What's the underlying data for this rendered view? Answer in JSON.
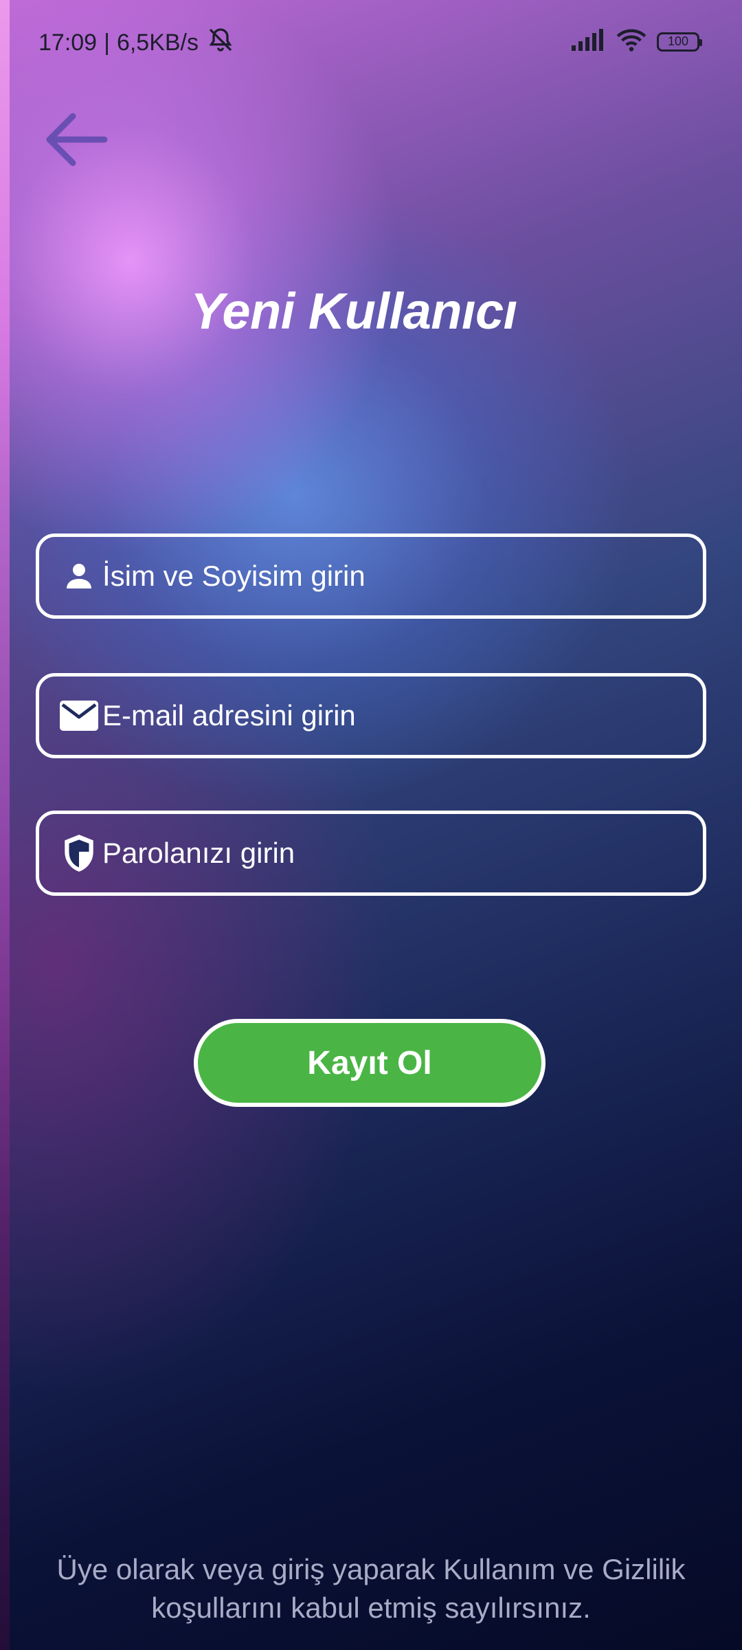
{
  "status_bar": {
    "time": "17:09",
    "separator": "|",
    "speed": "6,5KB/s",
    "battery": "100"
  },
  "header": {
    "title": "Yeni Kullanıcı"
  },
  "form": {
    "name_placeholder": "İsim ve Soyisim girin",
    "email_placeholder": "E-mail adresini girin",
    "password_placeholder": "Parolanızı girin",
    "submit_label": "Kayıt Ol"
  },
  "footer": {
    "terms_line1": "Üye olarak veya giriş yaparak Kullanım ve Gizlilik",
    "terms_line2": "koşullarını kabul etmiş sayılırsınız."
  },
  "icons": {
    "back": "arrow-left-icon",
    "name": "person-icon",
    "email": "envelope-icon",
    "password": "shield-icon",
    "mute": "bell-off-icon",
    "signal": "signal-icon",
    "wifi": "wifi-icon",
    "battery": "battery-icon"
  },
  "colors": {
    "accent_back_arrow": "#6a4fb3",
    "button_green": "#4ab545",
    "field_border": "#ffffff",
    "terms_text": "#a9acc6"
  }
}
